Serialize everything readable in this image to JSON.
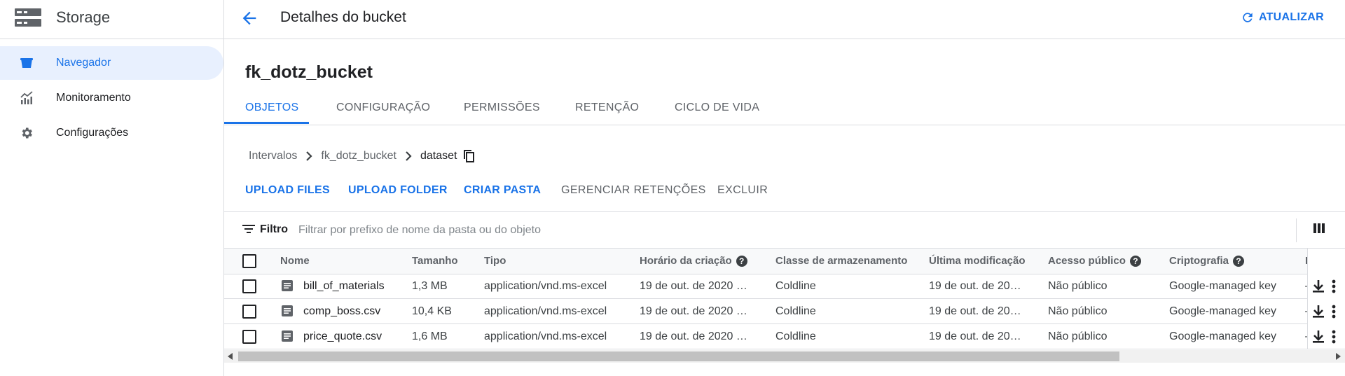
{
  "app": {
    "title": "Storage",
    "colors": {
      "accent": "#1a73e8",
      "text": "#202124",
      "muted": "#5f6368",
      "border": "#dadce0"
    }
  },
  "sidebar": {
    "items": [
      {
        "label": "Navegador",
        "icon": "bucket-icon",
        "active": true
      },
      {
        "label": "Monitoramento",
        "icon": "chart-icon",
        "active": false
      },
      {
        "label": "Configurações",
        "icon": "gear-icon",
        "active": false
      }
    ]
  },
  "header": {
    "title": "Detalhes do bucket",
    "refresh_label": "ATUALIZAR"
  },
  "bucket": {
    "name": "fk_dotz_bucket"
  },
  "tabs": [
    {
      "label": "OBJETOS",
      "active": true
    },
    {
      "label": "CONFIGURAÇÃO",
      "active": false
    },
    {
      "label": "PERMISSÕES",
      "active": false
    },
    {
      "label": "RETENÇÃO",
      "active": false
    },
    {
      "label": "CICLO DE VIDA",
      "active": false
    }
  ],
  "breadcrumb": [
    "Intervalos",
    "fk_dotz_bucket",
    "dataset"
  ],
  "actions": [
    {
      "label": "UPLOAD FILES",
      "enabled": true
    },
    {
      "label": "UPLOAD FOLDER",
      "enabled": true
    },
    {
      "label": "CRIAR PASTA",
      "enabled": true
    },
    {
      "label": "GERENCIAR RETENÇÕES",
      "enabled": false
    },
    {
      "label": "EXCLUIR",
      "enabled": false
    }
  ],
  "filter": {
    "label": "Filtro",
    "placeholder": "Filtrar por prefixo de nome da pasta ou do objeto"
  },
  "table": {
    "columns": [
      "Nome",
      "Tamanho",
      "Tipo",
      "Horário da criação",
      "Classe de armazenamento",
      "Última modificação",
      "Acesso público",
      "Criptografia",
      "D"
    ],
    "rows": [
      {
        "name": "bill_of_materials",
        "size": "1,3 MB",
        "type": "application/vnd.ms-excel",
        "created": "19 de out. de 2020 …",
        "class": "Coldline",
        "modified": "19 de out. de 20…",
        "access": "Não público",
        "encryption": "Google-managed key",
        "extra": "–"
      },
      {
        "name": "comp_boss.csv",
        "size": "10,4 KB",
        "type": "application/vnd.ms-excel",
        "created": "19 de out. de 2020 …",
        "class": "Coldline",
        "modified": "19 de out. de 20…",
        "access": "Não público",
        "encryption": "Google-managed key",
        "extra": "–"
      },
      {
        "name": "price_quote.csv",
        "size": "1,6 MB",
        "type": "application/vnd.ms-excel",
        "created": "19 de out. de 2020 …",
        "class": "Coldline",
        "modified": "19 de out. de 20…",
        "access": "Não público",
        "encryption": "Google-managed key",
        "extra": "–"
      }
    ]
  }
}
